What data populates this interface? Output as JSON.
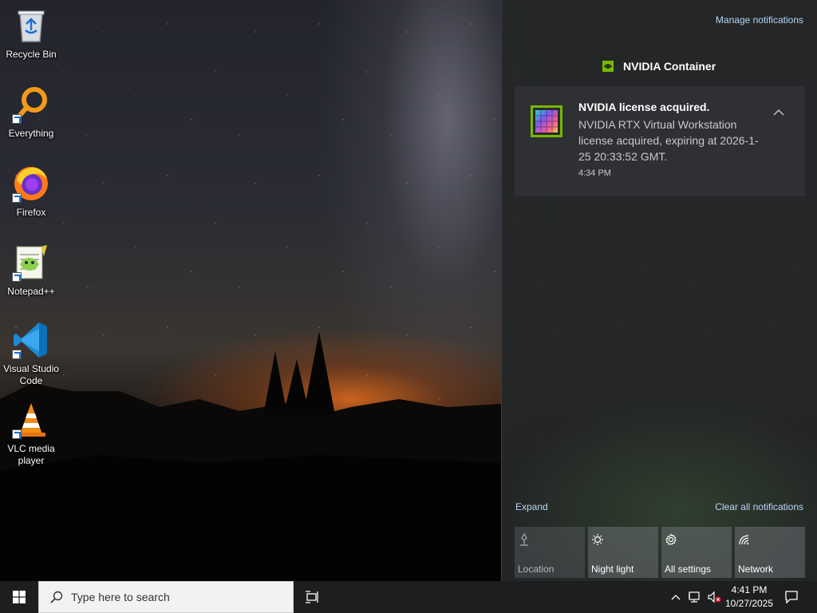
{
  "desktop": {
    "icons": [
      {
        "label": "Recycle Bin",
        "icon": "recycle-bin-icon"
      },
      {
        "label": "Everything",
        "icon": "everything-search-icon"
      },
      {
        "label": "Firefox",
        "icon": "firefox-icon"
      },
      {
        "label": "Notepad++",
        "icon": "notepad-plus-plus-icon"
      },
      {
        "label": "Visual Studio\nCode",
        "icon": "vscode-icon"
      },
      {
        "label": "VLC media\nplayer",
        "icon": "vlc-icon"
      }
    ]
  },
  "action_center": {
    "manage_label": "Manage notifications",
    "app_name": "NVIDIA Container",
    "notification": {
      "title": "NVIDIA license acquired.",
      "body": "NVIDIA RTX Virtual Workstation license acquired, expiring at 2026-1-25 20:33:52 GMT.",
      "time": "4:34 PM"
    },
    "expand_label": "Expand",
    "clear_label": "Clear all notifications",
    "quick_actions": [
      {
        "label": "Location",
        "icon": "location-icon",
        "enabled": false
      },
      {
        "label": "Night light",
        "icon": "night-light-icon",
        "enabled": true
      },
      {
        "label": "All settings",
        "icon": "gear-icon",
        "enabled": true
      },
      {
        "label": "Network",
        "icon": "network-icon",
        "enabled": true
      }
    ]
  },
  "taskbar": {
    "search_placeholder": "Type here to search",
    "time": "4:41 PM",
    "date": "10/27/2025"
  },
  "colors": {
    "link": "#b8d6f5",
    "taskbar": "#1d1e20",
    "panel": "#242628",
    "nvidia_green": "#76b900"
  }
}
